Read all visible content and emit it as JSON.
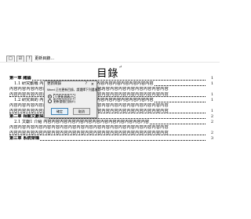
{
  "toolbar": {
    "items": [
      "□",
      "☑",
      "!",
      "更新目錄…"
    ]
  },
  "doc": {
    "title": "目錄",
    "title_mark": "↵",
    "rows": [
      {
        "kind": "chap",
        "text": "第一章  緒論",
        "page": "1"
      },
      {
        "kind": "sub",
        "text": "1.1 研究動機  內容內容內容內容內容內容內容內容內容內容內容內容內容內容",
        "page": "1"
      },
      {
        "kind": "text",
        "text": "內容內容內容內容內容內容內容內容內容內容內容內容內容內容內容內容內容內容內容",
        "page": ""
      },
      {
        "kind": "text",
        "text": "內容內容內容內容內容內容內容內容內容內容內容內容內容內容內容內容內容內容內容",
        "page": "1"
      },
      {
        "kind": "sub",
        "text": "1.2 研究目的  內容內容內容內容內容內容內容內容內容內容內容內容內容內容",
        "page": "1"
      },
      {
        "kind": "text",
        "text": "內容內容內容內容內容內容內容內容內容內容內容內容內容內容內容內容內容內容內容",
        "page": ""
      },
      {
        "kind": "text",
        "text": "內容內容內容內容內容內容內容內容內容內容內容內容內容內容內容內容內容內容內容",
        "page": "1"
      },
      {
        "kind": "chap",
        "text": "第二章  相關文獻探討",
        "page": "2"
      },
      {
        "kind": "sub",
        "text": "2.1 文獻1 介紹  內容內容內容內容內容內容內容內容內容內容內容內容內容",
        "page": "2"
      },
      {
        "kind": "text",
        "text": "內容內容內容內容內容內容內容內容內容內容內容內容內容內容內容內容內容內容內容",
        "page": ""
      },
      {
        "kind": "text",
        "text": "內容內容內容內容內容內容內容內容內容內容內容內容內容內容內容內容內容內容內容",
        "page": "2"
      },
      {
        "kind": "chap",
        "text": "第三章  系統架構",
        "page": "3"
      }
    ]
  },
  "dialog": {
    "title": "更新目錄",
    "help": "?",
    "close": "×",
    "message": "Word 正在更新目錄，請選擇下列選項之一：",
    "options": [
      "只更新頁碼(P)",
      "更新整個目錄(E)"
    ],
    "selected_index": 0,
    "ok_label": "確定",
    "cancel_label": "取消"
  }
}
